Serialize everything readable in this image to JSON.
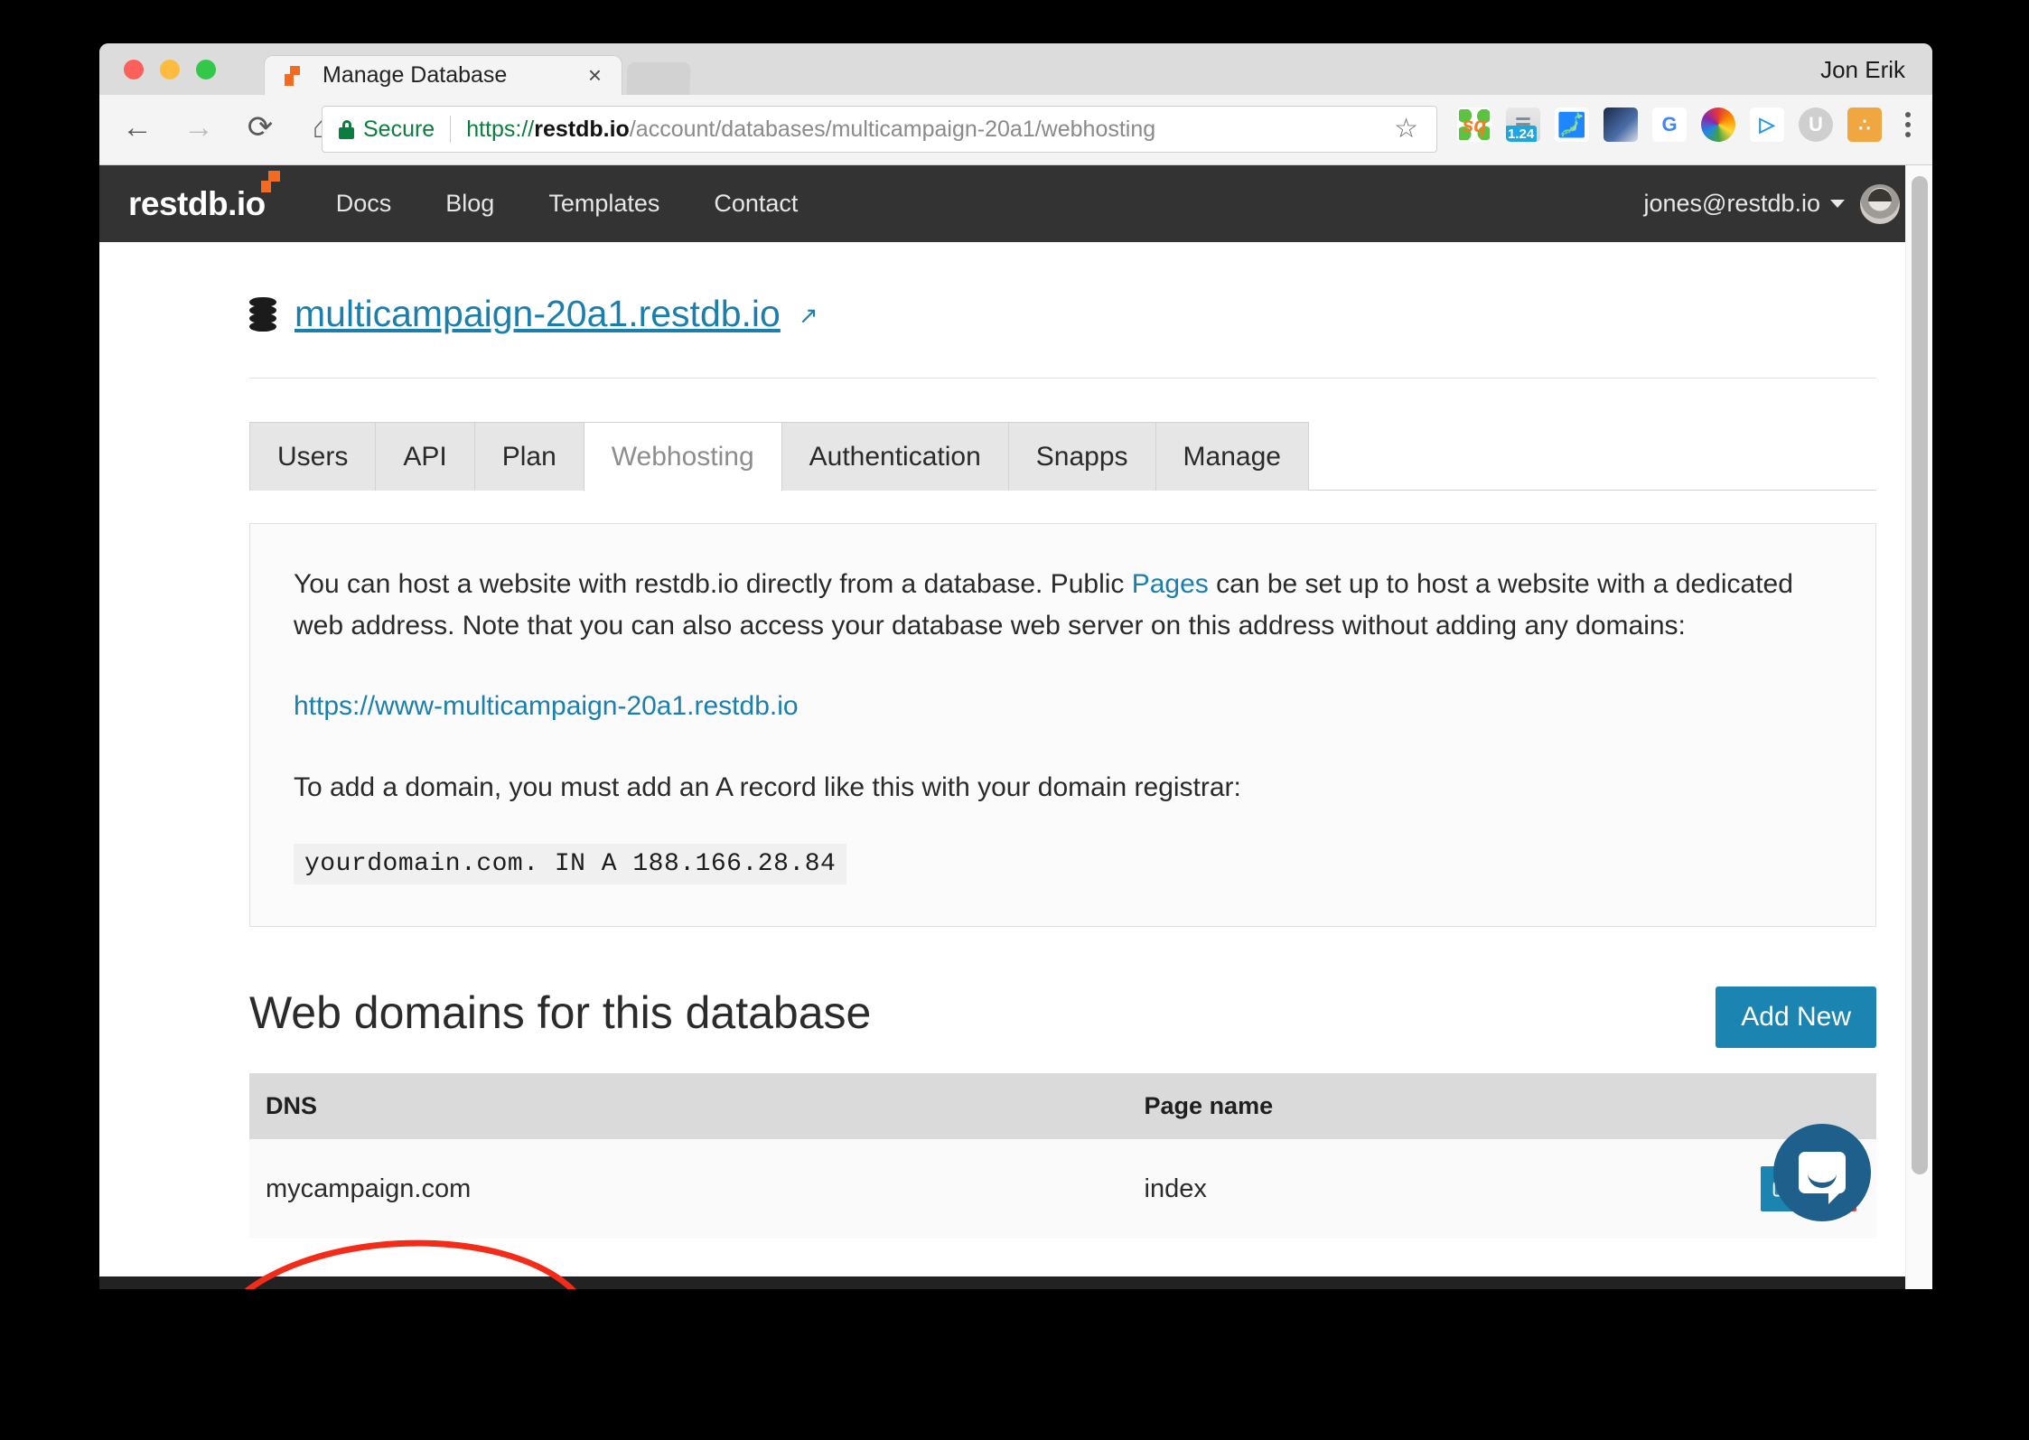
{
  "window": {
    "user_label": "Jon Erik",
    "tab_title": "Manage Database",
    "tab_close": "×"
  },
  "browser": {
    "back_icon": "←",
    "forward_icon": "→",
    "reload_icon": "⟳",
    "home_icon": "⌂",
    "secure_label": "Secure",
    "url": {
      "scheme": "https://",
      "host": "restdb.io",
      "path": "/account/databases/multicampaign-20a1/webhosting"
    },
    "star_icon": "☆",
    "extensions": [
      {
        "name": "squarespace-extension",
        "glyph": "sq"
      },
      {
        "name": "version-badge-extension",
        "glyph": "☰",
        "badge": "1.24"
      },
      {
        "name": "evernote-extension",
        "glyph": "◗"
      },
      {
        "name": "speedtest-extension",
        "glyph": ""
      },
      {
        "name": "google-translate-extension",
        "glyph": "G"
      },
      {
        "name": "colorpicker-extension",
        "glyph": ""
      },
      {
        "name": "tag-extension",
        "glyph": "{:}"
      },
      {
        "name": "ublock-extension",
        "glyph": "U"
      },
      {
        "name": "share-extension",
        "glyph": "∴"
      }
    ]
  },
  "site_nav": {
    "logo_text": "restdb.io",
    "links": [
      "Docs",
      "Blog",
      "Templates",
      "Contact"
    ],
    "user_email": "jones@restdb.io"
  },
  "page": {
    "db_title": "multicampaign-20a1.restdb.io",
    "db_external_icon": "↗",
    "tabs": [
      {
        "label": "Users",
        "active": false
      },
      {
        "label": "API",
        "active": false
      },
      {
        "label": "Plan",
        "active": false
      },
      {
        "label": "Webhosting",
        "active": true
      },
      {
        "label": "Authentication",
        "active": false
      },
      {
        "label": "Snapps",
        "active": false
      },
      {
        "label": "Manage",
        "active": false
      }
    ],
    "info": {
      "para1_before": "You can host a website with restdb.io directly from a database. Public ",
      "para1_link": "Pages",
      "para1_after": " can be set up to host a website with a dedicated web address. Note that you can also access your database web server on this address without adding any domains:",
      "hosting_url": "https://www-multicampaign-20a1.restdb.io",
      "para2": "To add a domain, you must add an A record like this with your domain registrar:",
      "a_record": "yourdomain.com. IN A 188.166.28.84"
    },
    "domains_section": {
      "title": "Web domains for this database",
      "add_new_label": "Add New",
      "columns": [
        "DNS",
        "Page name",
        ""
      ],
      "rows": [
        {
          "dns": "mycampaign.com",
          "page_name": "index",
          "edit_icon": "✎",
          "delete_icon": "✕"
        }
      ]
    }
  }
}
